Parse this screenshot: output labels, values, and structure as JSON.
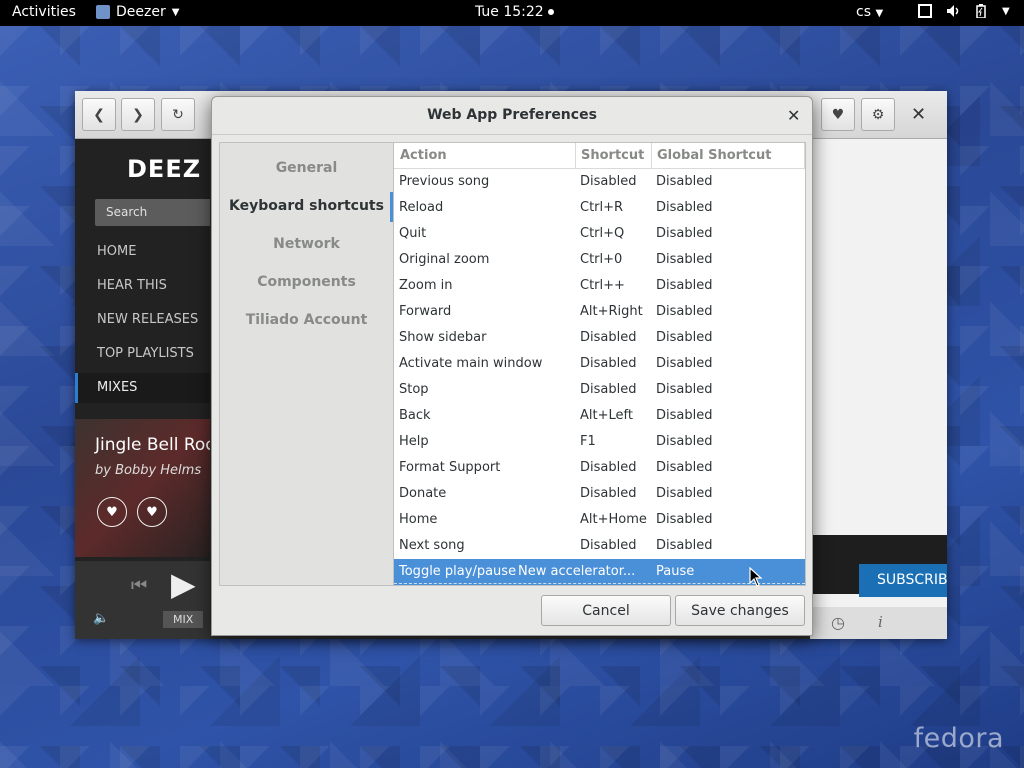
{
  "topbar": {
    "activities": "Activities",
    "app_name": "Deezer",
    "clock": "Tue 15:22",
    "language": "cs"
  },
  "app": {
    "logo": "DEEZ",
    "search_placeholder": "Search",
    "nav": [
      "HOME",
      "HEAR THIS",
      "NEW RELEASES",
      "TOP PLAYLISTS",
      "MIXES"
    ],
    "song_title": "Jingle Bell Rock",
    "song_artist": "by Bobby Helms",
    "mix_label": "MIX",
    "subscribe": "SUBSCRIB"
  },
  "dialog": {
    "title": "Web App Preferences",
    "sidebar": [
      "General",
      "Keyboard shortcuts",
      "Network",
      "Components",
      "Tiliado Account"
    ],
    "active_sidebar_index": 1,
    "columns": [
      "Action",
      "Shortcut",
      "Global Shortcut"
    ],
    "rows": [
      [
        "Previous song",
        "Disabled",
        "Disabled"
      ],
      [
        "Reload",
        "Ctrl+R",
        "Disabled"
      ],
      [
        "Quit",
        "Ctrl+Q",
        "Disabled"
      ],
      [
        "Original zoom",
        "Ctrl+0",
        "Disabled"
      ],
      [
        "Zoom in",
        "Ctrl++",
        "Disabled"
      ],
      [
        "Forward",
        "Alt+Right",
        "Disabled"
      ],
      [
        "Show sidebar",
        "Disabled",
        "Disabled"
      ],
      [
        "Activate main window",
        "Disabled",
        "Disabled"
      ],
      [
        "Stop",
        "Disabled",
        "Disabled"
      ],
      [
        "Back",
        "Alt+Left",
        "Disabled"
      ],
      [
        "Help",
        "F1",
        "Disabled"
      ],
      [
        "Format Support",
        "Disabled",
        "Disabled"
      ],
      [
        "Donate",
        "Disabled",
        "Disabled"
      ],
      [
        "Home",
        "Alt+Home",
        "Disabled"
      ],
      [
        "Next song",
        "Disabled",
        "Disabled"
      ],
      [
        "Toggle play/pause",
        "New accelerator...",
        "Pause"
      ]
    ],
    "selected_row_index": 15,
    "cancel": "Cancel",
    "save": "Save changes"
  },
  "wallpaper_brand": "fedora",
  "colors": {
    "selection": "#4a90d9",
    "topbar": "#000000",
    "subscribe": "#1a6fb5"
  }
}
